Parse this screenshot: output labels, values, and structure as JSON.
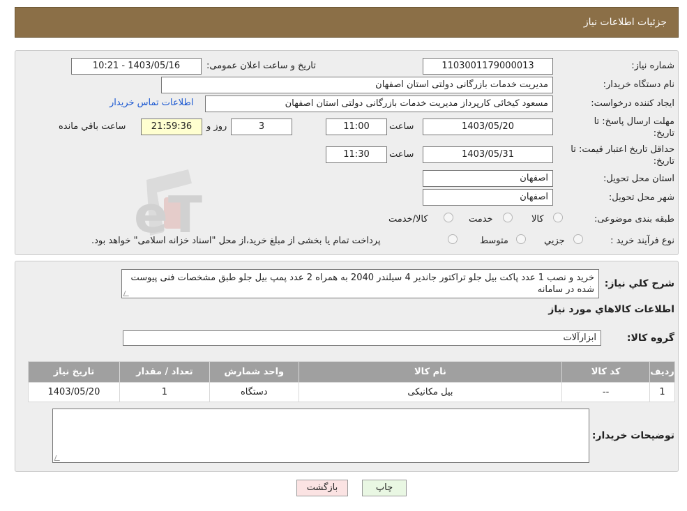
{
  "header": {
    "title": "جزئیات اطلاعات نیاز"
  },
  "fields": {
    "need_number_label": "شماره نیاز:",
    "need_number": "1103001179000013",
    "announce_label": "تاریخ و ساعت اعلان عمومی:",
    "announce_value": "1403/05/16 - 10:21",
    "buyer_org_label": "نام دستگاه خریدار:",
    "buyer_org": "مدیریت خدمات بازرگانی دولتی استان اصفهان",
    "creator_label": "ایجاد کننده درخواست:",
    "creator": "مسعود کیخائی کارپرداز مدیریت خدمات بازرگانی دولتی استان اصفهان",
    "contact_link": "اطلاعات تماس خریدار",
    "deadline_label": "مهلت ارسال پاسخ: تا تاریخ:",
    "deadline_date": "1403/05/20",
    "time_label": "ساعت",
    "deadline_time": "11:00",
    "days": "3",
    "days_label": "روز و",
    "remaining_time": "21:59:36",
    "remaining_label": "ساعت باقي مانده",
    "validity_label": "حداقل تاریخ اعتبار قیمت: تا تاریخ:",
    "validity_date": "1403/05/31",
    "validity_time": "11:30",
    "province_label": "استان محل تحویل:",
    "province": "اصفهان",
    "city_label": "شهر محل تحویل:",
    "city": "اصفهان",
    "category_label": "طبقه بندی موضوعی:",
    "category_options": [
      "کالا",
      "خدمت",
      "کالا/خدمت"
    ],
    "process_label": "نوع فرآیند خرید :",
    "process_options": [
      "جزيي",
      "متوسط"
    ],
    "payment_note": "پرداخت تمام یا بخشی از مبلغ خرید،از محل \"اسناد خزانه اسلامی\" خواهد بود."
  },
  "details": {
    "desc_label": "شرح كلي نياز:",
    "description": "خرید و نصب 1 عدد پاکت بیل جلو تراکتور جاندیر 4 سیلندر 2040  به همراه 2 عدد پمپ بیل جلو طبق مشخصات فنی پیوست شده در سامانه",
    "goods_info_title": "اطلاعات كالاهاي مورد نياز",
    "goods_group_label": "گروه كالا:",
    "goods_group": "ابزارآلات",
    "table": {
      "headers": [
        "رديف",
        "كد كالا",
        "نام كالا",
        "واحد شمارش",
        "تعداد / مقدار",
        "تاريخ نياز"
      ],
      "rows": [
        [
          "1",
          "--",
          "بیل مکانیکی",
          "دستگاه",
          "1",
          "1403/05/20"
        ]
      ]
    },
    "buyer_notes_label": "توضیحات خریدار:",
    "buyer_notes": ""
  },
  "buttons": {
    "print": "چاپ",
    "back": "بازگشت"
  },
  "watermark_text": "AriaTender.neT",
  "colors": {
    "header_bg": "#8b6f47",
    "panel_bg": "#eeeeee",
    "table_header": "#a0a0a0",
    "link": "#1a57d1"
  }
}
